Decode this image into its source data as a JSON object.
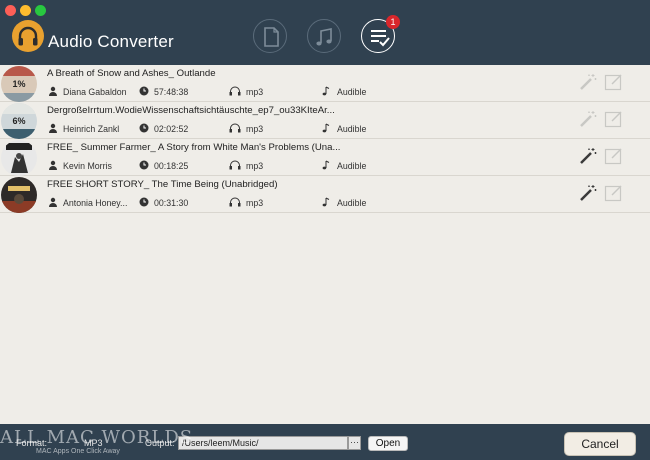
{
  "app": {
    "title": "Audio Converter",
    "badge_count": "1"
  },
  "books": [
    {
      "title": "A Breath of Snow and Ashes_ Outlande",
      "author": "Diana Gabaldon",
      "duration": "57:48:38",
      "format": "mp3",
      "source": "Audible",
      "thumb_text": "1%",
      "thumb_bg": "#d9c9b8"
    },
    {
      "title": "DergroßeIrrtum.WodieWissenschaftsichtäuschte_ep7_ou33KIteAr...",
      "author": "Heinrich Zankl",
      "duration": "02:02:52",
      "format": "mp3",
      "source": "Audible",
      "thumb_text": "6%",
      "thumb_bg": "#cfd7da"
    },
    {
      "title": "FREE_ Summer Farmer_ A Story from White Man's Problems (Una...",
      "author": "Kevin Morris",
      "duration": "00:18:25",
      "format": "mp3",
      "source": "Audible",
      "thumb_text": "",
      "thumb_bg": "#e8e8e8"
    },
    {
      "title": "FREE SHORT STORY_ The Time Being (Unabridged)",
      "author": "Antonia Honey...",
      "duration": "00:31:30",
      "format": "mp3",
      "source": "Audible",
      "thumb_text": "",
      "thumb_bg": "#2e2a28"
    }
  ],
  "bottom": {
    "format_label": "Format:",
    "format_value": "MP3",
    "output_label": "Output:",
    "output_path": "/Users/leem/Music/",
    "browse_label": "···",
    "open_label": "Open",
    "cancel_label": "Cancel"
  },
  "watermark": {
    "text": "ALL MAC WORLDS",
    "sub": "MAC Apps One Click Away"
  },
  "colors": {
    "header_bg": "#304150",
    "list_bg": "#efede8",
    "logo": "#e9a12f",
    "badge": "#d8262b"
  },
  "icons": {
    "author": "person-icon",
    "duration": "clock-icon",
    "format": "headphones-icon",
    "source": "music-note-icon",
    "convert": "magic-wand-icon",
    "edit": "edit-icon"
  }
}
